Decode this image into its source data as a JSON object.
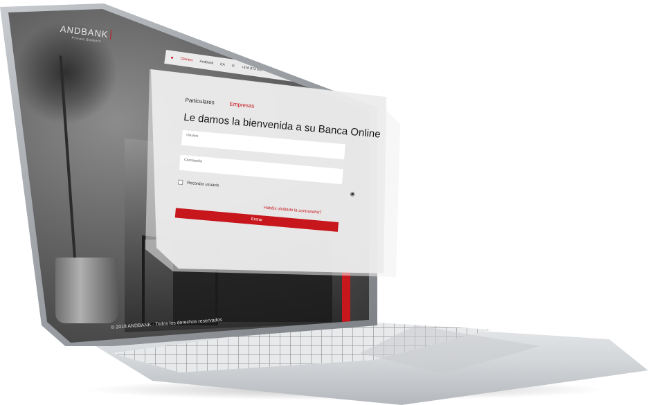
{
  "brand": {
    "name": "ANDBANK",
    "tagline": "Private Bankers"
  },
  "topnav": {
    "items": [
      "Clientes",
      "Andbank",
      "CA"
    ],
    "phone": "+376 873 600"
  },
  "login": {
    "tabs": [
      "Particulares",
      "Empresas"
    ],
    "active_tab": "Empresas",
    "welcome": "Le damos la bienvenida a su Banca Online",
    "user_label": "Usuario",
    "password_label": "Contraseña",
    "remember_label": "Recordar usuario",
    "forgot_label": "Habéis olvidado la contraseña?",
    "submit_label": "Entrar"
  },
  "footer": {
    "text": "© 2018 ANDBANK · Todos los derechos reservados"
  },
  "colors": {
    "accent": "#c8161d",
    "panel": "#ececec",
    "text": "#1a1a1a"
  }
}
